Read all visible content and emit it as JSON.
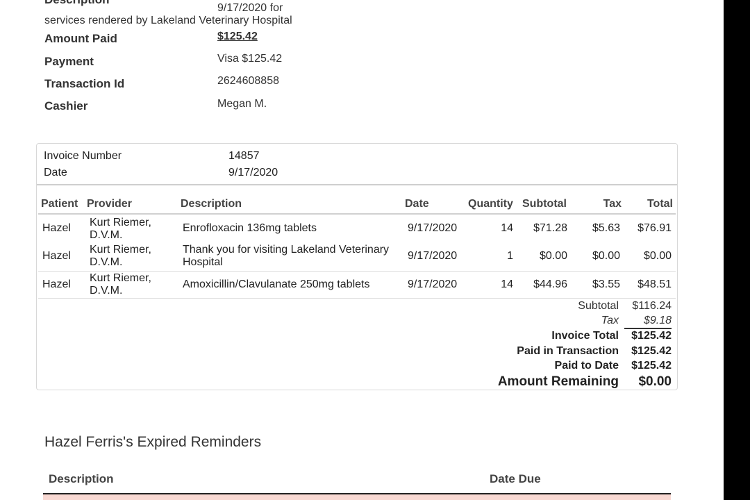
{
  "receipt": {
    "description_heading": "Description",
    "description_line1": "9/17/2020 for",
    "description_line2": "services rendered by Lakeland Veterinary Hospital",
    "amount_paid_label": "Amount Paid",
    "amount_paid_value": "$125.42",
    "payment_label": "Payment",
    "payment_value": "Visa $125.42",
    "transaction_label": "Transaction Id",
    "transaction_value": "2624608858",
    "cashier_label": "Cashier",
    "cashier_value": "Megan M."
  },
  "invoice": {
    "number_label": "Invoice Number",
    "number_value": "14857",
    "date_label": "Date",
    "date_value": "9/17/2020",
    "columns": {
      "patient": "Patient",
      "provider": "Provider",
      "description": "Description",
      "date": "Date",
      "quantity": "Quantity",
      "subtotal": "Subtotal",
      "tax": "Tax",
      "total": "Total"
    },
    "rows": [
      {
        "patient": "Hazel",
        "provider_line1": "Kurt Riemer,",
        "provider_line2": "D.V.M.",
        "description_line1": "Enrofloxacin 136mg tablets",
        "description_line2": "",
        "date": "9/17/2020",
        "quantity": "14",
        "subtotal": "$71.28",
        "tax": "$5.63",
        "total": "$76.91"
      },
      {
        "patient": "Hazel",
        "provider_line1": "Kurt Riemer,",
        "provider_line2": "D.V.M.",
        "description_line1": "Thank you for visiting Lakeland Veterinary",
        "description_line2": "Hospital",
        "date": "9/17/2020",
        "quantity": "1",
        "subtotal": "$0.00",
        "tax": "$0.00",
        "total": "$0.00"
      },
      {
        "patient": "Hazel",
        "provider_line1": "Kurt Riemer,",
        "provider_line2": "D.V.M.",
        "description_line1": "Amoxicillin/Clavulanate 250mg tablets",
        "description_line2": "",
        "date": "9/17/2020",
        "quantity": "14",
        "subtotal": "$44.96",
        "tax": "$3.55",
        "total": "$48.51"
      }
    ],
    "summary": {
      "subtotal_label": "Subtotal",
      "subtotal_value": "$116.24",
      "tax_label": "Tax",
      "tax_value": "$9.18",
      "invoice_total_label": "Invoice Total",
      "invoice_total_value": "$125.42",
      "paid_in_transaction_label": "Paid in Transaction",
      "paid_in_transaction_value": "$125.42",
      "paid_to_date_label": "Paid to Date",
      "paid_to_date_value": "$125.42",
      "amount_remaining_label": "Amount Remaining",
      "amount_remaining_value": "$0.00"
    }
  },
  "reminders": {
    "title": "Hazel Ferris's Expired Reminders",
    "col_description": "Description",
    "col_date_due": "Date Due",
    "row_highlight_color": "#f9d9d3"
  }
}
